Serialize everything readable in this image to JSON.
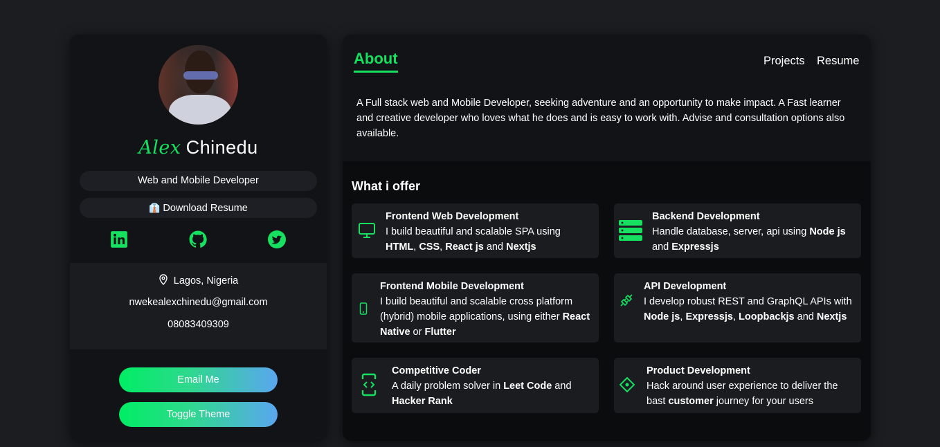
{
  "profile": {
    "first_name": "Alex",
    "last_name": "Chinedu",
    "role": "Web and Mobile Developer",
    "resume_button": "Download Resume",
    "resume_glyph": "👔",
    "socials": [
      "linkedin-icon",
      "github-icon",
      "twitter-icon"
    ],
    "location": "Lagos, Nigeria",
    "email": "nwekealexchinedu@gmail.com",
    "phone": "08083409309",
    "email_button": "Email Me",
    "theme_button": "Toggle Theme"
  },
  "nav": {
    "about": "About",
    "projects": "Projects",
    "resume": "Resume"
  },
  "about_text": "A Full stack web and Mobile Developer, seeking adventure and an opportunity to make impact. A Fast learner and creative developer who loves what he does and is easy to work with. Advise and consultation options also available.",
  "offers_title": "What i offer",
  "offers": [
    {
      "title": "Frontend Web Development",
      "icon": "monitor-icon",
      "parts": [
        "I build beautiful and scalable SPA using ",
        "HTML",
        ", ",
        "CSS",
        ", ",
        "React js",
        " and ",
        "Nextjs"
      ]
    },
    {
      "title": "Backend Development",
      "icon": "server-icon",
      "parts": [
        "Handle database, server, api using ",
        "Node js",
        " and ",
        "Expressjs"
      ]
    },
    {
      "title": "Frontend Mobile Development",
      "icon": "mobile-icon",
      "parts": [
        "I build beautiful and scalable cross platform (hybrid) mobile applications, using either ",
        "React Native",
        " or ",
        "Flutter"
      ]
    },
    {
      "title": "API Development",
      "icon": "plug-icon",
      "parts": [
        "I develop robust REST and GraphQL APIs with ",
        "Node js",
        ", ",
        "Expressjs",
        ", ",
        "Loopbackjs",
        " and ",
        "Nextjs"
      ]
    },
    {
      "title": "Competitive Coder",
      "icon": "code-icon",
      "parts": [
        "A daily problem solver in ",
        "Leet Code",
        " and ",
        "Hacker Rank"
      ]
    },
    {
      "title": "Product Development",
      "icon": "product-icon",
      "parts": [
        "Hack around user experience to deliver the bast ",
        "customer",
        " journey for your users"
      ]
    }
  ],
  "colors": {
    "accent": "#16e05f",
    "gradient_start": "#00ed64",
    "gradient_end": "#5aa6f0",
    "page_bg": "#1c1d20",
    "card_bg": "#121316"
  }
}
